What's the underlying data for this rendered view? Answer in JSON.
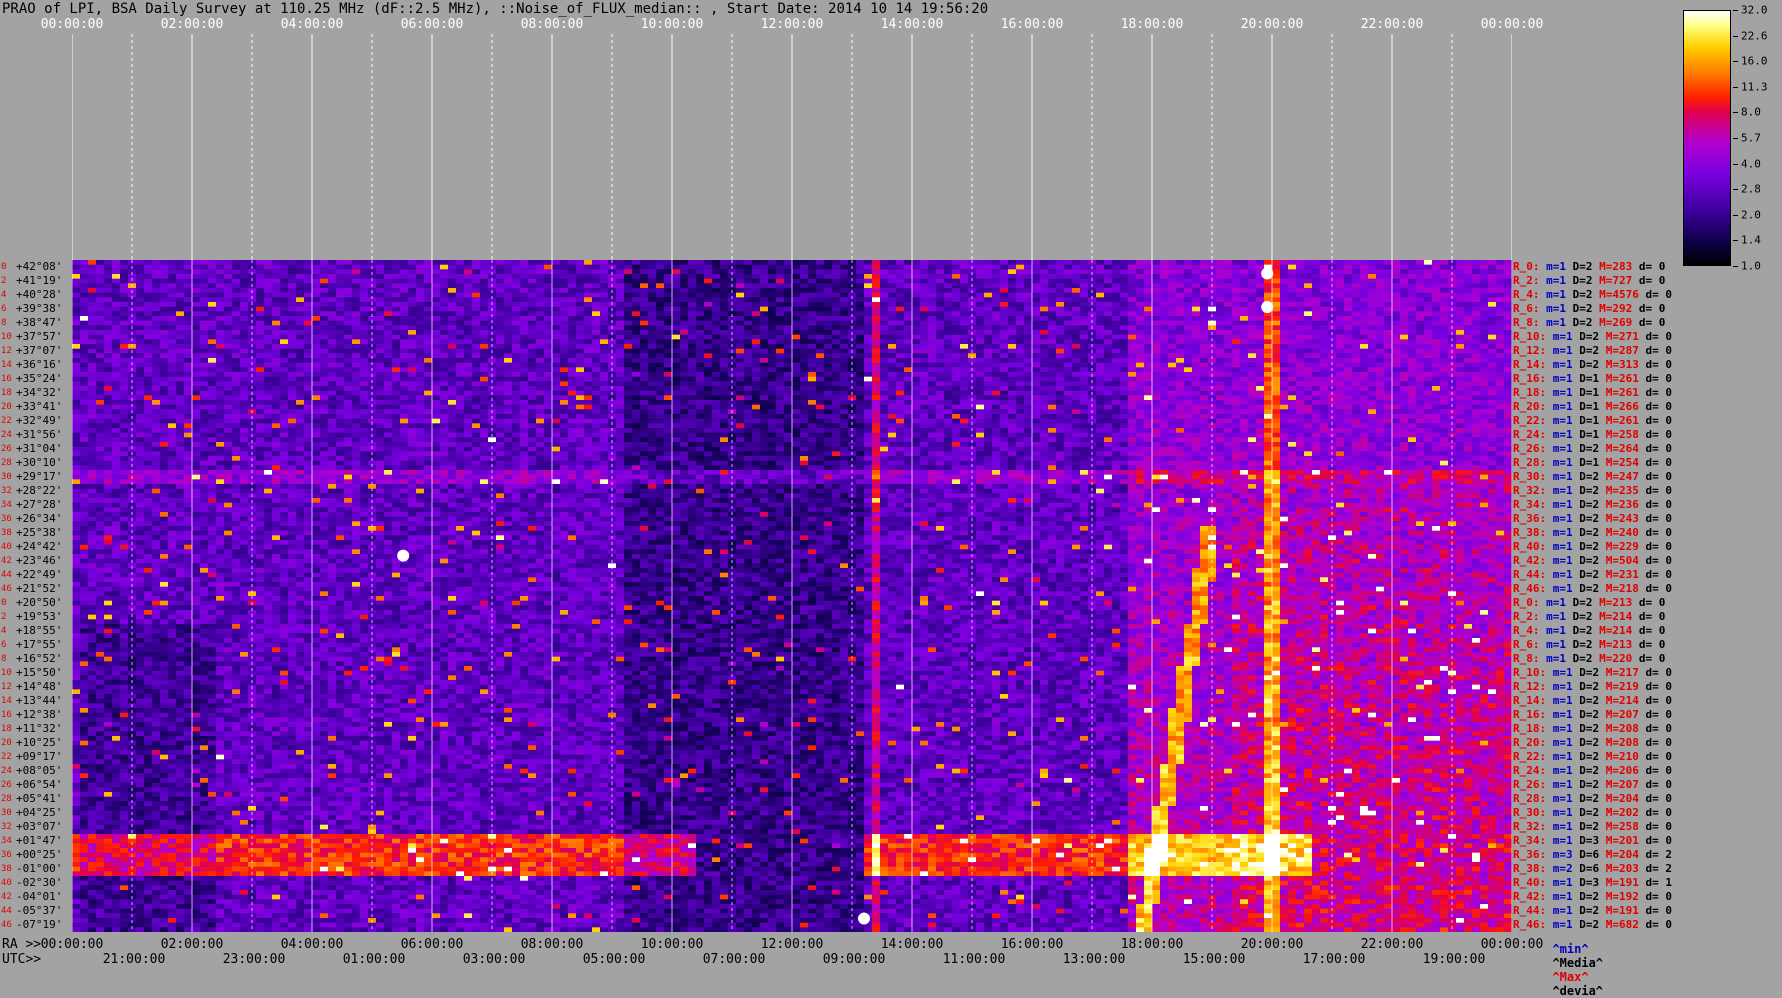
{
  "title": "PRAO of LPI, BSA Daily Survey at 110.25 MHz (dF::2.5 MHz), ::Noise_of_FLUX_median:: , Start Date: 2014 10 14 19:56:20",
  "top_axis": {
    "ticks": [
      "00:00:00",
      "02:00:00",
      "04:00:00",
      "06:00:00",
      "08:00:00",
      "10:00:00",
      "12:00:00",
      "14:00:00",
      "16:00:00",
      "18:00:00",
      "20:00:00",
      "22:00:00",
      "00:00:00"
    ]
  },
  "bottom_axis": {
    "ra_prefix": "RA >>",
    "ra_ticks": [
      "00:00:00",
      "02:00:00",
      "04:00:00",
      "06:00:00",
      "08:00:00",
      "10:00:00",
      "12:00:00",
      "14:00:00",
      "16:00:00",
      "18:00:00",
      "20:00:00",
      "22:00:00",
      "00:00:00"
    ],
    "utc_prefix": "UTC>>",
    "utc_ticks": [
      "21:00:00",
      "23:00:00",
      "01:00:00",
      "03:00:00",
      "05:00:00",
      "07:00:00",
      "09:00:00",
      "11:00:00",
      "13:00:00",
      "15:00:00",
      "17:00:00",
      "19:00:00"
    ]
  },
  "stats_header": {
    "min": "^min^",
    "median": "^Media^",
    "max": "^Max^",
    "dev": "^devia^"
  },
  "colors": {
    "background": "#a3a3a3",
    "red_label": "#e00000",
    "blue_label": "#0000c0",
    "white_line": "#ffffff"
  },
  "colorbar": {
    "ticks": [
      "32.0",
      "22.6",
      "16.0",
      "11.3",
      "8.0",
      "5.7",
      "4.0",
      "2.8",
      "2.0",
      "1.4",
      "1.0"
    ]
  },
  "chart_data": {
    "type": "heatmap",
    "title": "PRAO of LPI, BSA Daily Survey at 110.25 MHz (dF::2.5 MHz), ::Noise_of_FLUX_median:: , Start Date: 2014 10 14 19:56:20",
    "x_axis": "RA (hh:mm:ss) / UTC",
    "y_rows_dec": [
      "+42°08'",
      "+41°19'",
      "+40°28'",
      "+39°38'",
      "+38°47'",
      "+37°57'",
      "+37°07'",
      "+36°16'",
      "+35°24'",
      "+34°32'",
      "+33°41'",
      "+32°49'",
      "+31°56'",
      "+31°04'",
      "+30°10'",
      "+29°17'",
      "+28°22'",
      "+27°28'",
      "+26°34'",
      "+25°38'",
      "+24°42'",
      "+23°46'",
      "+22°49'",
      "+21°52'",
      "+20°50'",
      "+19°53'",
      "+18°55'",
      "+17°55'",
      "+16°52'",
      "+15°50'",
      "+14°48'",
      "+13°44'",
      "+12°38'",
      "+11°32'",
      "+10°25'",
      "+09°17'",
      "+08°05'",
      "+06°54'",
      "+05°41'",
      "+04°25'",
      "+03°07'",
      "+01°47'",
      "+00°25'",
      "-01°00'",
      "-02°30'",
      "-04°01'",
      "-05°37'",
      "-07°19'"
    ],
    "y_row_index": [
      "0",
      "2",
      "4",
      "6",
      "8",
      "10",
      "12",
      "14",
      "16",
      "18",
      "20",
      "22",
      "24",
      "26",
      "28",
      "30",
      "32",
      "34",
      "36",
      "38",
      "40",
      "42",
      "44",
      "46",
      "0",
      "2",
      "4",
      "6",
      "8",
      "10",
      "12",
      "14",
      "16",
      "18",
      "20",
      "22",
      "24",
      "26",
      "28",
      "30",
      "32",
      "34",
      "36",
      "38",
      "40",
      "42",
      "44",
      "46"
    ],
    "colorbar_range": [
      1.0,
      32.0
    ],
    "colorbar_scale": "log",
    "row_stats": [
      {
        "r": "R_0:",
        "m": "m=1",
        "d": "D=2",
        "mx": "M=283",
        "dv": "d= 0"
      },
      {
        "r": "R_2:",
        "m": "m=1",
        "d": "D=2",
        "mx": "M=727",
        "dv": "d= 0"
      },
      {
        "r": "R_4:",
        "m": "m=1",
        "d": "D=2",
        "mx": "M=4576",
        "dv": "d= 0"
      },
      {
        "r": "R_6:",
        "m": "m=1",
        "d": "D=2",
        "mx": "M=292",
        "dv": "d= 0"
      },
      {
        "r": "R_8:",
        "m": "m=1",
        "d": "D=2",
        "mx": "M=269",
        "dv": "d= 0"
      },
      {
        "r": "R_10:",
        "m": "m=1",
        "d": "D=2",
        "mx": "M=271",
        "dv": "d= 0"
      },
      {
        "r": "R_12:",
        "m": "m=1",
        "d": "D=2",
        "mx": "M=287",
        "dv": "d= 0"
      },
      {
        "r": "R_14:",
        "m": "m=1",
        "d": "D=2",
        "mx": "M=313",
        "dv": "d= 0"
      },
      {
        "r": "R_16:",
        "m": "m=1",
        "d": "D=1",
        "mx": "M=261",
        "dv": "d= 0"
      },
      {
        "r": "R_18:",
        "m": "m=1",
        "d": "D=1",
        "mx": "M=261",
        "dv": "d= 0"
      },
      {
        "r": "R_20:",
        "m": "m=1",
        "d": "D=1",
        "mx": "M=266",
        "dv": "d= 0"
      },
      {
        "r": "R_22:",
        "m": "m=1",
        "d": "D=1",
        "mx": "M=261",
        "dv": "d= 0"
      },
      {
        "r": "R_24:",
        "m": "m=1",
        "d": "D=1",
        "mx": "M=258",
        "dv": "d= 0"
      },
      {
        "r": "R_26:",
        "m": "m=1",
        "d": "D=2",
        "mx": "M=264",
        "dv": "d= 0"
      },
      {
        "r": "R_28:",
        "m": "m=1",
        "d": "D=1",
        "mx": "M=254",
        "dv": "d= 0"
      },
      {
        "r": "R_30:",
        "m": "m=1",
        "d": "D=2",
        "mx": "M=247",
        "dv": "d= 0"
      },
      {
        "r": "R_32:",
        "m": "m=1",
        "d": "D=2",
        "mx": "M=235",
        "dv": "d= 0"
      },
      {
        "r": "R_34:",
        "m": "m=1",
        "d": "D=2",
        "mx": "M=236",
        "dv": "d= 0"
      },
      {
        "r": "R_36:",
        "m": "m=1",
        "d": "D=2",
        "mx": "M=243",
        "dv": "d= 0"
      },
      {
        "r": "R_38:",
        "m": "m=1",
        "d": "D=2",
        "mx": "M=240",
        "dv": "d= 0"
      },
      {
        "r": "R_40:",
        "m": "m=1",
        "d": "D=2",
        "mx": "M=229",
        "dv": "d= 0"
      },
      {
        "r": "R_42:",
        "m": "m=1",
        "d": "D=2",
        "mx": "M=504",
        "dv": "d= 0"
      },
      {
        "r": "R_44:",
        "m": "m=1",
        "d": "D=2",
        "mx": "M=231",
        "dv": "d= 0"
      },
      {
        "r": "R_46:",
        "m": "m=1",
        "d": "D=2",
        "mx": "M=218",
        "dv": "d= 0"
      },
      {
        "r": "R_0:",
        "m": "m=1",
        "d": "D=2",
        "mx": "M=213",
        "dv": "d= 0"
      },
      {
        "r": "R_2:",
        "m": "m=1",
        "d": "D=2",
        "mx": "M=214",
        "dv": "d= 0"
      },
      {
        "r": "R_4:",
        "m": "m=1",
        "d": "D=2",
        "mx": "M=214",
        "dv": "d= 0"
      },
      {
        "r": "R_6:",
        "m": "m=1",
        "d": "D=2",
        "mx": "M=213",
        "dv": "d= 0"
      },
      {
        "r": "R_8:",
        "m": "m=1",
        "d": "D=2",
        "mx": "M=220",
        "dv": "d= 0"
      },
      {
        "r": "R_10:",
        "m": "m=1",
        "d": "D=2",
        "mx": "M=217",
        "dv": "d= 0"
      },
      {
        "r": "R_12:",
        "m": "m=1",
        "d": "D=2",
        "mx": "M=219",
        "dv": "d= 0"
      },
      {
        "r": "R_14:",
        "m": "m=1",
        "d": "D=2",
        "mx": "M=214",
        "dv": "d= 0"
      },
      {
        "r": "R_16:",
        "m": "m=1",
        "d": "D=2",
        "mx": "M=207",
        "dv": "d= 0"
      },
      {
        "r": "R_18:",
        "m": "m=1",
        "d": "D=2",
        "mx": "M=208",
        "dv": "d= 0"
      },
      {
        "r": "R_20:",
        "m": "m=1",
        "d": "D=2",
        "mx": "M=208",
        "dv": "d= 0"
      },
      {
        "r": "R_22:",
        "m": "m=1",
        "d": "D=2",
        "mx": "M=210",
        "dv": "d= 0"
      },
      {
        "r": "R_24:",
        "m": "m=1",
        "d": "D=2",
        "mx": "M=206",
        "dv": "d= 0"
      },
      {
        "r": "R_26:",
        "m": "m=1",
        "d": "D=2",
        "mx": "M=207",
        "dv": "d= 0"
      },
      {
        "r": "R_28:",
        "m": "m=1",
        "d": "D=2",
        "mx": "M=204",
        "dv": "d= 0"
      },
      {
        "r": "R_30:",
        "m": "m=1",
        "d": "D=2",
        "mx": "M=202",
        "dv": "d= 0"
      },
      {
        "r": "R_32:",
        "m": "m=1",
        "d": "D=2",
        "mx": "M=258",
        "dv": "d= 0"
      },
      {
        "r": "R_34:",
        "m": "m=1",
        "d": "D=3",
        "mx": "M=201",
        "dv": "d= 0"
      },
      {
        "r": "R_36:",
        "m": "m=3",
        "d": "D=6",
        "mx": "M=204",
        "dv": "d= 2"
      },
      {
        "r": "R_38:",
        "m": "m=2",
        "d": "D=6",
        "mx": "M=203",
        "dv": "d= 2"
      },
      {
        "r": "R_40:",
        "m": "m=1",
        "d": "D=3",
        "mx": "M=191",
        "dv": "d= 1"
      },
      {
        "r": "R_42:",
        "m": "m=1",
        "d": "D=2",
        "mx": "M=192",
        "dv": "d= 0"
      },
      {
        "r": "R_44:",
        "m": "m=1",
        "d": "D=2",
        "mx": "M=191",
        "dv": "d= 0"
      },
      {
        "r": "R_46:",
        "m": "m=1",
        "d": "D=2",
        "mx": "M=682",
        "dv": "d= 0"
      }
    ]
  }
}
